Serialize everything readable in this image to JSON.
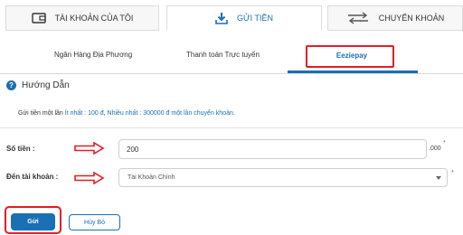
{
  "top_tabs": {
    "my_accounts": "TÀI KHOẢN CỦA TÔI",
    "deposit": "GỬI TIỀN",
    "transfer": "CHUYỂN KHOẢN"
  },
  "sub_tabs": {
    "local_bank": "Ngân Hàng Địa Phương",
    "online_payment": "Thanh toán Trực tuyến",
    "eeziepay": "Eeziepay"
  },
  "guide": {
    "title": "Hướng Dẫn",
    "text_prefix": "Gửi tiền một lần",
    "min_label": "Ít nhất :",
    "min_value": "100 đ",
    "separator": ",",
    "max_label": "Nhiều nhất :",
    "max_value": "300000 đ một lần chuyển khoản."
  },
  "form": {
    "amount_label": "Số tiền :",
    "amount_value": "200",
    "amount_suffix": ".000",
    "required_mark": "*",
    "account_label": "Đến tài khoản :",
    "account_selected": "Tài Khoản Chính"
  },
  "buttons": {
    "submit": "Gửi",
    "cancel": "Hủy Bỏ"
  },
  "colors": {
    "accent": "#1a6fb5",
    "highlight": "#e01e24"
  },
  "icons": {
    "my_accounts": "wallet-icon",
    "deposit": "download-icon",
    "transfer": "transfer-arrows-icon",
    "guide": "info-icon",
    "annotation": "red-arrow-icon"
  }
}
